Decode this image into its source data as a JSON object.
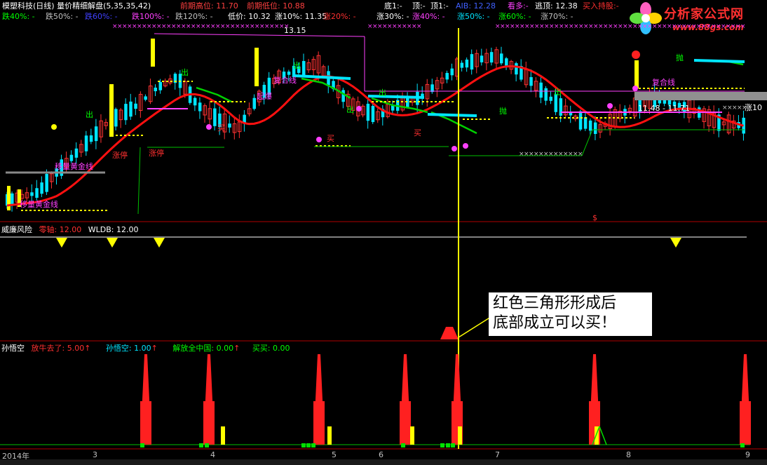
{
  "colors": {
    "up": "#ff3232",
    "down": "#00e5ff",
    "yellow": "#ffff00",
    "green": "#00d000",
    "magenta": "#ff40ff",
    "white": "#ffffff",
    "red_line": "#ff1010"
  },
  "header": {
    "title": "模塑科技(日线)",
    "formula": "量价精细解盘(5,35,35,42)",
    "prev_high_label": "前期高位:",
    "prev_high": "11.70",
    "prev_low_label": "前期低位:",
    "prev_low": "10.88",
    "bottom1_label": "底1:",
    "bottom1": "-",
    "top_label": "顶:",
    "top": "-",
    "top1_label": "顶1:",
    "top1": "-",
    "aib_label": "AIB:",
    "aib": "12.28",
    "kanduo_label": "看多:",
    "kanduo": "-",
    "taoding_label": "逃顶:",
    "taoding": "12.38",
    "buy_hold_label": "买入持股:",
    "buy_hold": "-"
  },
  "row2": [
    {
      "label": "跌40%:",
      "value": "-",
      "color": "#00ff00"
    },
    {
      "label": "跌50%:",
      "value": "-",
      "color": "#c0c0c0"
    },
    {
      "label": "跌60%:",
      "value": "-",
      "color": "#4040ff"
    },
    {
      "label": "跌100%:",
      "value": "-",
      "color": "#ff40ff"
    },
    {
      "label": "跌120%:",
      "value": "-",
      "color": "#c0c0c0"
    },
    {
      "label": "低价:",
      "value": "10.32",
      "color": "#ffffff"
    },
    {
      "label": "涨10%:",
      "value": "11.35",
      "color": "#ffffff"
    },
    {
      "label": "涨20%:",
      "value": "-",
      "color": "#ff3030"
    },
    {
      "label": "涨30%:",
      "value": "-",
      "color": "#ffffff"
    },
    {
      "label": "涨40%:",
      "value": "-",
      "color": "#ff40ff"
    },
    {
      "label": "涨50%:",
      "value": "-",
      "color": "#00e5ff"
    },
    {
      "label": "涨60%:",
      "value": "-",
      "color": "#00ff00"
    },
    {
      "label": "涨70%:",
      "value": "-",
      "color": "#c0c0c0"
    }
  ],
  "logo": {
    "name": "分析家公式网",
    "url": "www.88gs.com"
  },
  "annotations": {
    "high_price": "13.15",
    "range": "11.48 - 11.71",
    "rise10": "涨10",
    "s_mark": "$",
    "labels": [
      {
        "text": "移量黄金线",
        "color": "#ff40ff"
      },
      {
        "text": "移量黄金线",
        "color": "#ff40ff"
      },
      {
        "text": "涨停",
        "color": "#ff3030"
      },
      {
        "text": "涨停",
        "color": "#ff3030"
      },
      {
        "text": "起爆",
        "color": "#ff40ff"
      },
      {
        "text": "复合线",
        "color": "#ff40ff"
      },
      {
        "text": "复合线",
        "color": "#ff40ff"
      },
      {
        "text": "买",
        "color": "#ff3030"
      },
      {
        "text": "买",
        "color": "#ff3030"
      },
      {
        "text": "买",
        "color": "#ff3030"
      },
      {
        "text": "出",
        "color": "#00ff00"
      },
      {
        "text": "出",
        "color": "#00ff00"
      },
      {
        "text": "出",
        "color": "#00ff00"
      },
      {
        "text": "出",
        "color": "#00ff00"
      },
      {
        "text": "出",
        "color": "#00ff00"
      },
      {
        "text": "出",
        "color": "#00ff00"
      },
      {
        "text": "抛",
        "color": "#00ff00"
      },
      {
        "text": "抛",
        "color": "#00ff00"
      }
    ]
  },
  "pane2": {
    "title": "威廉风险",
    "zero_label": "零轴:",
    "zero": "12.00",
    "wldb_label": "WLDB:",
    "wldb": "12.00"
  },
  "callout": {
    "line1": "红色三角形形成后",
    "line2": "底部成立可以买！"
  },
  "pane3": {
    "title": "孙悟空",
    "a_label": "放牛去了:",
    "a_value": "5.00",
    "b_label": "孙悟空:",
    "b_value": "1.00",
    "c_label": "解放全中国:",
    "c_value": "0.00",
    "d_label": "买买:",
    "d_value": "0.00",
    "arrow": "↑"
  },
  "axis": {
    "year": "2014年",
    "months": [
      "3",
      "4",
      "5",
      "6",
      "7",
      "8",
      "9"
    ]
  }
}
